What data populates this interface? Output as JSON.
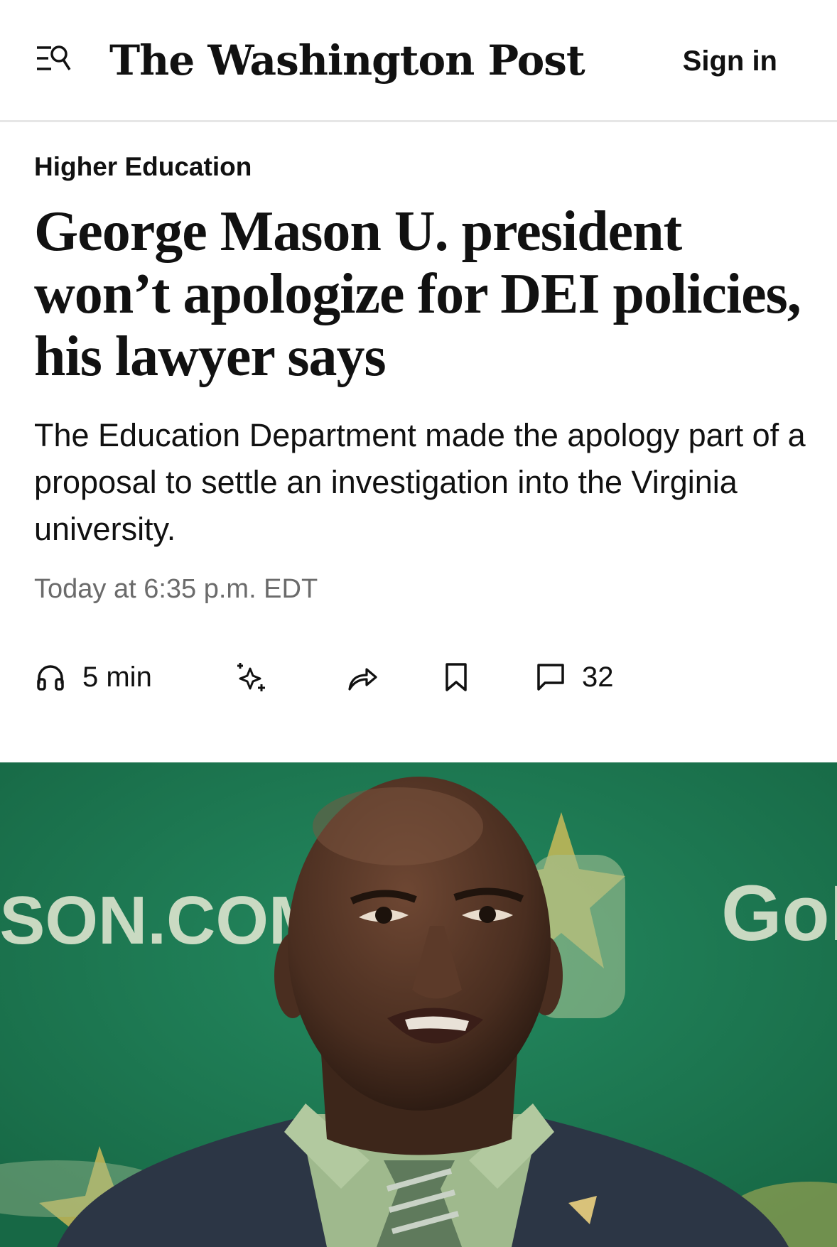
{
  "header": {
    "logo_text": "The Washington Post",
    "sign_in_label": "Sign in",
    "menu_icon": "menu-search-icon"
  },
  "article": {
    "kicker": "Higher Education",
    "headline": "George Mason U. president won’t apologize for DEI policies, his lawyer says",
    "dek": "The Education Department made the apology part of a proposal to settle an investigation into the Virginia university.",
    "timestamp": "Today at 6:35 p.m. EDT"
  },
  "toolbar": {
    "listen_label": "5 min",
    "comments_count": "32",
    "icons": [
      "headphones-icon",
      "sparkle-icon",
      "share-icon",
      "bookmark-icon",
      "comment-icon"
    ]
  },
  "photo": {
    "background_sign_left": "ASON.COM",
    "background_sign_right": "GoM",
    "colors": {
      "backdrop": "#1f7a55",
      "skin": "#5a3a2a",
      "suit": "#2c3645",
      "shirt": "#9fb98d"
    }
  }
}
